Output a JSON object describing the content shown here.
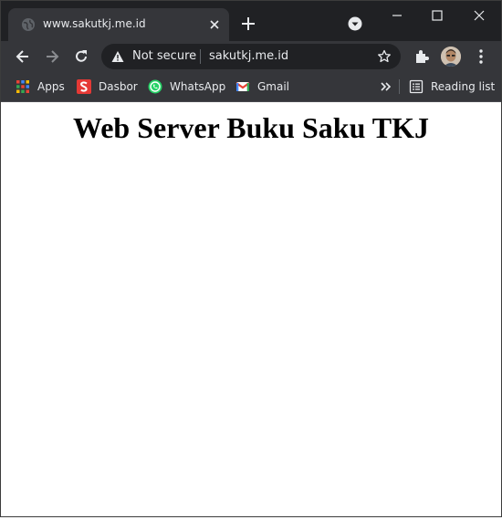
{
  "browser": {
    "tab": {
      "title": "www.sakutkj.me.id",
      "favicon": "globe-icon"
    },
    "omnibox": {
      "security_label": "Not secure",
      "url": "sakutkj.me.id"
    },
    "bookmarks": [
      {
        "label": "Apps",
        "icon": "apps-grid-icon"
      },
      {
        "label": "Dasbor",
        "icon": "dasbor-s-icon"
      },
      {
        "label": "WhatsApp",
        "icon": "whatsapp-icon"
      },
      {
        "label": "Gmail",
        "icon": "gmail-icon"
      }
    ],
    "reading_list": {
      "label": "Reading list",
      "icon": "reading-list-icon"
    }
  },
  "page": {
    "heading": "Web Server Buku Saku TKJ"
  },
  "colors": {
    "chrome_dark": "#202124",
    "chrome_toolbar": "#35363a",
    "text_light": "#e8eaed",
    "page_background": "#ffffff"
  }
}
